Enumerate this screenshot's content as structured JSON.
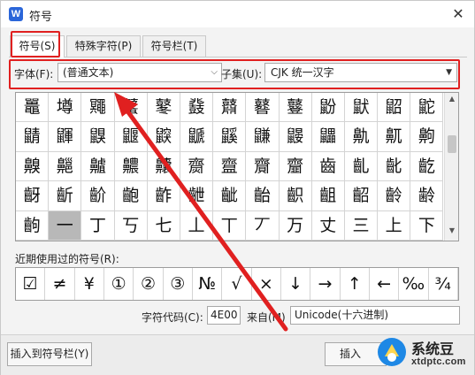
{
  "window": {
    "title": "符号",
    "app_icon": "W",
    "close": "✕"
  },
  "tabs": [
    {
      "label": "符号(S)",
      "active": true
    },
    {
      "label": "特殊字符(P)",
      "active": false
    },
    {
      "label": "符号栏(T)",
      "active": false
    }
  ],
  "filters": {
    "font_label": "字体(F):",
    "font_value": "(普通文本)",
    "subset_label": "子集(U):",
    "subset_value": "CJK 统一汉字"
  },
  "grid": {
    "rows": [
      [
        "鼉",
        "壿",
        "鼆",
        "鼜",
        "鼕",
        "鼗",
        "鼘",
        "鼛",
        "鼟",
        "鼢",
        "鼣",
        "鼦",
        "鼧"
      ],
      [
        "鼱",
        "鼲",
        "鼳",
        "鼴",
        "鼵",
        "鼶",
        "鼷",
        "鼸",
        "鼹",
        "鼺",
        "鼽",
        "鼿",
        "齁"
      ],
      [
        "齅",
        "齆",
        "齇",
        "齈",
        "齉",
        "齌",
        "齍",
        "齎",
        "齏",
        "齒",
        "齓",
        "齔",
        "齕"
      ],
      [
        "齖",
        "齗",
        "齘",
        "齙",
        "齚",
        "齛",
        "齜",
        "齝",
        "齞",
        "齟",
        "齠",
        "齡",
        "齢"
      ],
      [
        "齣",
        "一",
        "丁",
        "丂",
        "七",
        "丄",
        "丅",
        "丆",
        "万",
        "丈",
        "三",
        "上",
        "下"
      ]
    ],
    "selected_char": "一"
  },
  "recent": {
    "label": "近期使用过的符号(R):",
    "symbols": [
      "☑",
      "≠",
      "¥",
      "①",
      "②",
      "③",
      "№",
      "√",
      "×",
      "↓",
      "→",
      "↑",
      "←",
      "‰",
      "¾"
    ]
  },
  "code": {
    "label": "字符代码(C):",
    "value": "4E00",
    "from_label": "来自(M)",
    "from_value": "Unicode(十六进制)"
  },
  "buttons": {
    "insert_to_bar": "插入到符号栏(Y)",
    "insert": "插入"
  },
  "watermark": {
    "name": "系统豆",
    "url": "xtdptc.com"
  },
  "colors": {
    "highlight": "#e02020",
    "accent": "#2b66d9"
  }
}
